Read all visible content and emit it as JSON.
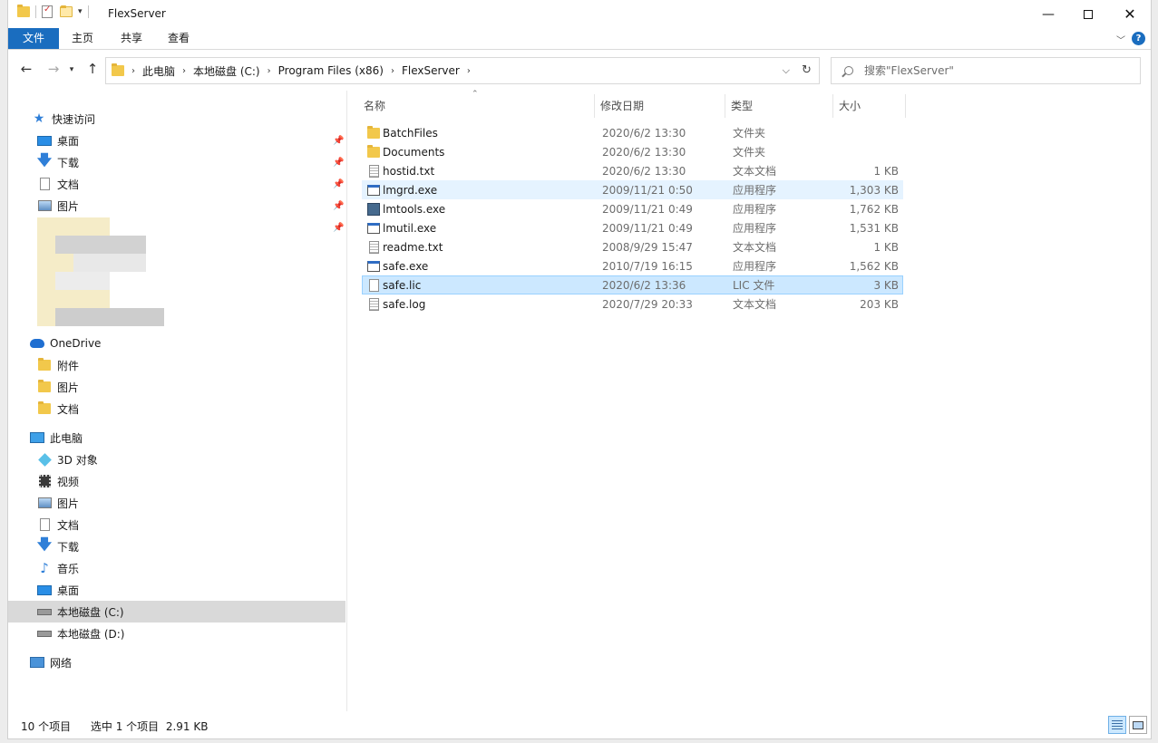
{
  "window": {
    "title": "FlexServer"
  },
  "ribbon": {
    "tabs": [
      "文件",
      "主页",
      "共享",
      "查看"
    ],
    "help": "?"
  },
  "address": {
    "crumbs": [
      "此电脑",
      "本地磁盘 (C:)",
      "Program Files (x86)",
      "FlexServer"
    ],
    "search_placeholder": "搜索\"FlexServer\""
  },
  "nav": {
    "quick_access": "快速访问",
    "quick_items": [
      "桌面",
      "下载",
      "文档",
      "图片"
    ],
    "onedrive": "OneDrive",
    "onedrive_items": [
      "附件",
      "图片",
      "文档"
    ],
    "this_pc": "此电脑",
    "pc_items": [
      "3D 对象",
      "视频",
      "图片",
      "文档",
      "下载",
      "音乐",
      "桌面",
      "本地磁盘 (C:)",
      "本地磁盘 (D:)"
    ],
    "network": "网络"
  },
  "columns": {
    "name": "名称",
    "date": "修改日期",
    "type": "类型",
    "size": "大小"
  },
  "files": [
    {
      "name": "BatchFiles",
      "date": "2020/6/2 13:30",
      "type": "文件夹",
      "size": "",
      "icon": "folder-icon"
    },
    {
      "name": "Documents",
      "date": "2020/6/2 13:30",
      "type": "文件夹",
      "size": "",
      "icon": "folder-icon"
    },
    {
      "name": "hostid.txt",
      "date": "2020/6/2 13:30",
      "type": "文本文档",
      "size": "1 KB",
      "icon": "text-file-icon"
    },
    {
      "name": "lmgrd.exe",
      "date": "2009/11/21 0:50",
      "type": "应用程序",
      "size": "1,303 KB",
      "icon": "exe-icon"
    },
    {
      "name": "lmtools.exe",
      "date": "2009/11/21 0:49",
      "type": "应用程序",
      "size": "1,762 KB",
      "icon": "lmtools-icon"
    },
    {
      "name": "lmutil.exe",
      "date": "2009/11/21 0:49",
      "type": "应用程序",
      "size": "1,531 KB",
      "icon": "exe-icon"
    },
    {
      "name": "readme.txt",
      "date": "2008/9/29 15:47",
      "type": "文本文档",
      "size": "1 KB",
      "icon": "text-file-icon"
    },
    {
      "name": "safe.exe",
      "date": "2010/7/19 16:15",
      "type": "应用程序",
      "size": "1,562 KB",
      "icon": "exe-icon"
    },
    {
      "name": "safe.lic",
      "date": "2020/6/2 13:36",
      "type": "LIC 文件",
      "size": "3 KB",
      "icon": "blank-file-icon"
    },
    {
      "name": "safe.log",
      "date": "2020/7/29 20:33",
      "type": "文本文档",
      "size": "203 KB",
      "icon": "text-file-icon"
    }
  ],
  "status": {
    "count": "10 个项目",
    "selection": "选中 1 个项目  2.91 KB"
  }
}
